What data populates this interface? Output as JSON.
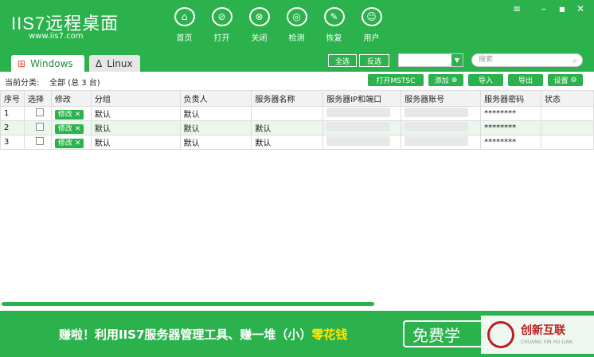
{
  "app": {
    "logo": "IIS7远程桌面",
    "url": "www.iis7.com"
  },
  "nav": [
    {
      "label": "首页",
      "icon": "home-icon",
      "glyph": "⌂"
    },
    {
      "label": "打开",
      "icon": "link-icon",
      "glyph": "⊘"
    },
    {
      "label": "关闭",
      "icon": "unlink-icon",
      "glyph": "⊗"
    },
    {
      "label": "检测",
      "icon": "scan-icon",
      "glyph": "◎"
    },
    {
      "label": "恢复",
      "icon": "wrench-icon",
      "glyph": "✎"
    },
    {
      "label": "用户",
      "icon": "user-icon",
      "glyph": "☺"
    }
  ],
  "tabs": {
    "windows": "Windows",
    "linux": "Linux"
  },
  "filter": {
    "select_all": "全选",
    "invert": "反选",
    "search_placeholder": "搜索"
  },
  "toolbar": {
    "category_label": "当前分类:",
    "category_value": "全部 (总 3 台)",
    "open_mstsc": "打开MSTSC",
    "add": "添加",
    "import": "导入",
    "export": "导出",
    "settings": "设置"
  },
  "table": {
    "headers": [
      "序号",
      "选择",
      "修改",
      "分组",
      "负责人",
      "服务器名称",
      "服务器IP和端口",
      "服务器账号",
      "服务器密码",
      "状态"
    ],
    "edit_label": "修改",
    "rows": [
      {
        "index": "1",
        "group": "默认",
        "owner": "默认",
        "name": "",
        "password": "********"
      },
      {
        "index": "2",
        "group": "默认",
        "owner": "默认",
        "name": "默认",
        "password": "********"
      },
      {
        "index": "3",
        "group": "默认",
        "owner": "默认",
        "name": "默认",
        "password": "********"
      }
    ]
  },
  "banner": {
    "text": "赚啦！利用IIS7服务器管理工具、赚一堆（小）",
    "highlight": "零花钱",
    "button": "免费学"
  },
  "watermark": {
    "cn": "创新互联",
    "en": "CHUANG XIN HU LIAN"
  }
}
